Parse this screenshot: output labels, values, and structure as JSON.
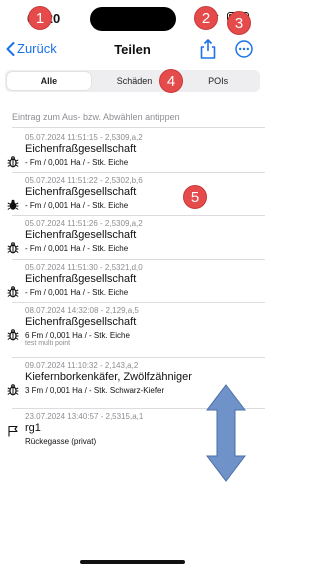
{
  "status": {
    "time": "09:20"
  },
  "nav": {
    "back_label": "Zurück",
    "title": "Teilen"
  },
  "segments": [
    "Alle",
    "Schäden",
    "POIs"
  ],
  "hint": "Eintrag zum Aus- bzw. Abwählen antippen",
  "entries": [
    {
      "meta": "05.07.2024 11:51:15 - 2,5309,a,2",
      "title": "Eichenfraßgesellschaft",
      "detail": "- Fm / 0,001 Ha / - Stk. Eiche",
      "note": "",
      "icon": "bug-outline-icon"
    },
    {
      "meta": "05.07.2024 11:51:22 - 2,5302,b,6",
      "title": "Eichenfraßgesellschaft",
      "detail": "- Fm / 0,001 Ha / - Stk. Eiche",
      "note": "",
      "icon": "bug-filled-icon"
    },
    {
      "meta": "05.07.2024 11:51:26 - 2,5309,a,2",
      "title": "Eichenfraßgesellschaft",
      "detail": "- Fm / 0,001 Ha / - Stk. Eiche",
      "note": "",
      "icon": "bug-outline-icon"
    },
    {
      "meta": "05.07.2024 11:51:30 - 2,5321,d,0",
      "title": "Eichenfraßgesellschaft",
      "detail": "- Fm / 0,001 Ha / - Stk. Eiche",
      "note": "",
      "icon": "bug-outline-icon"
    },
    {
      "meta": "08.07.2024 14:32:08 - 2,129,a,5",
      "title": "Eichenfraßgesellschaft",
      "detail": "6 Fm / 0,001 Ha / - Stk. Eiche",
      "note": "test multi point",
      "icon": "bug-outline-icon"
    },
    {
      "meta": "09.07.2024 11:10:32 - 2,143,a,2",
      "title": "Kiefernborkenkäfer, Zwölfzähniger",
      "detail": "3 Fm / 0,001 Ha / - Stk. Schwarz-Kiefer",
      "note": "",
      "icon": "bug-outline-icon"
    },
    {
      "meta": "23.07.2024 13:40:57 - 2,5315,a,1",
      "title": "rg1",
      "detail": "Rückegasse (privat)",
      "note": "",
      "icon": "flag-icon"
    }
  ],
  "markers": [
    "1",
    "2",
    "3",
    "4",
    "5"
  ],
  "colors": {
    "accent": "#1a73e8",
    "marker": "#e54b4b",
    "arrow": "#6f93c9"
  }
}
